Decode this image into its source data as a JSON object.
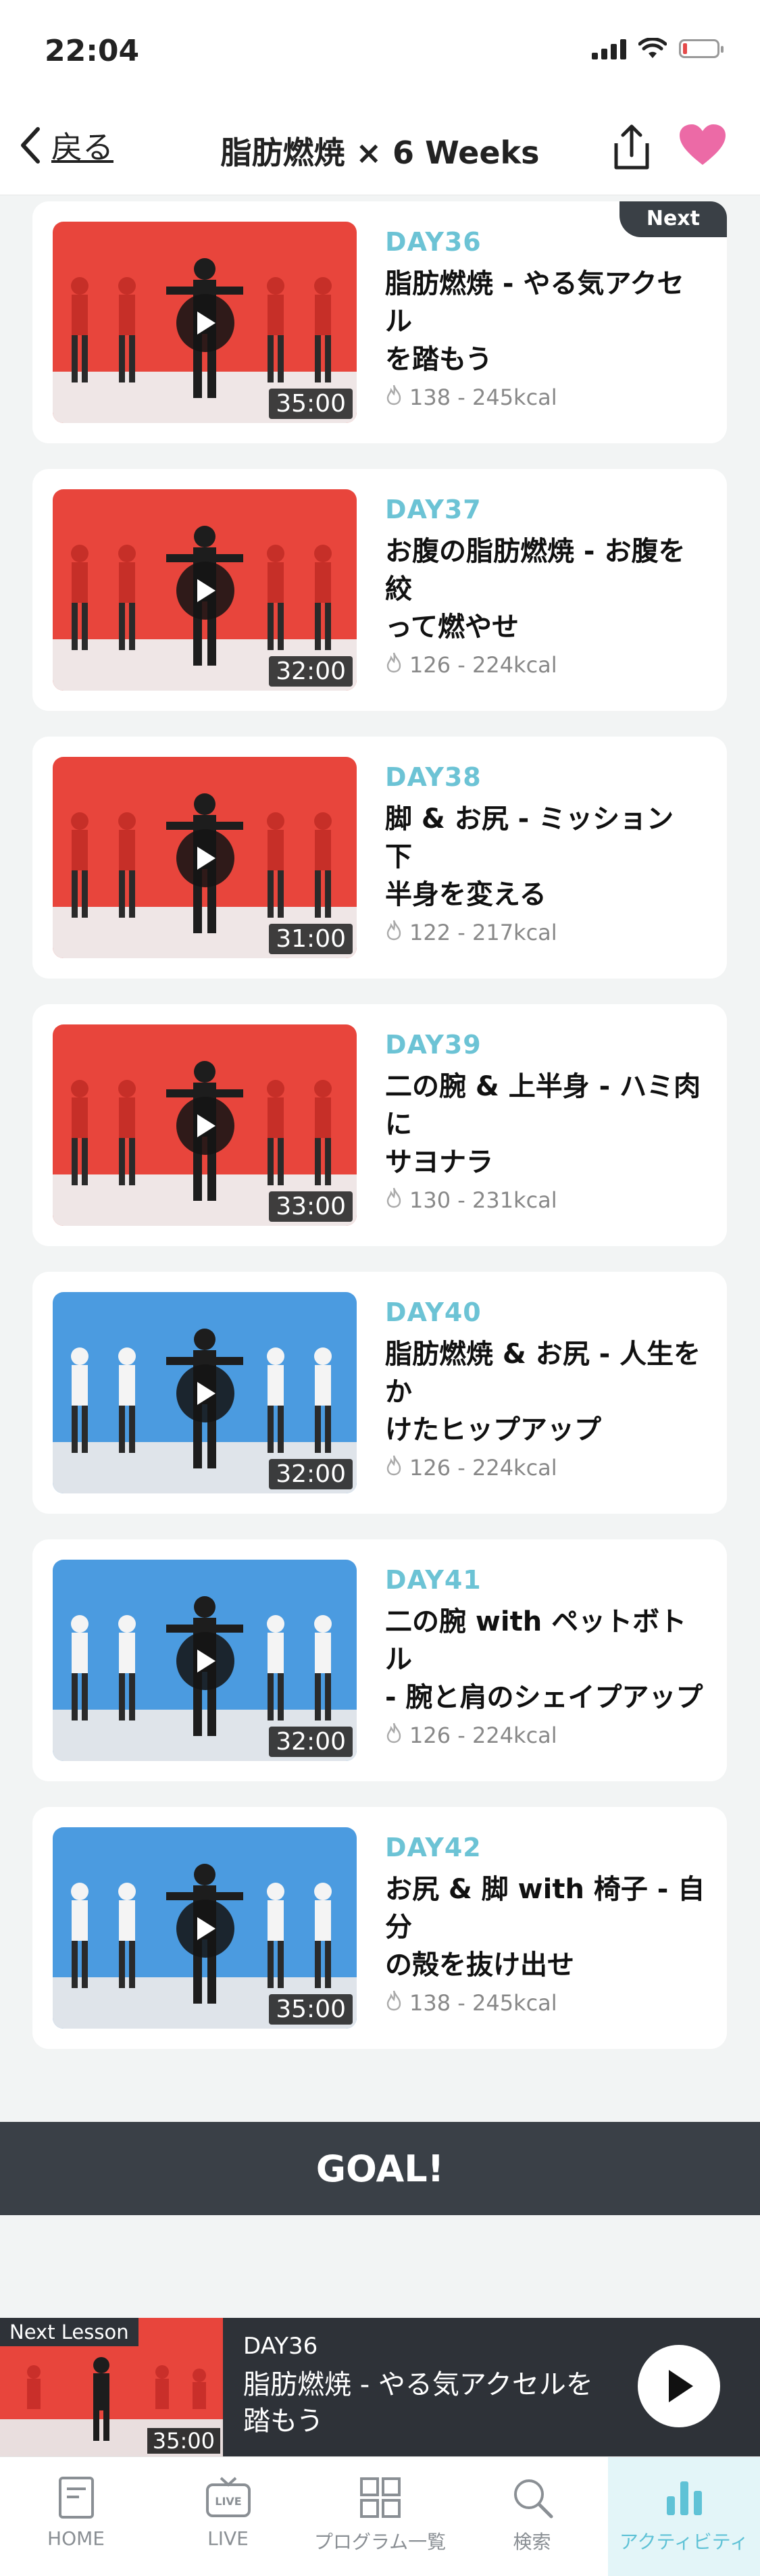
{
  "status_bar": {
    "time": "22:04"
  },
  "nav": {
    "back_label": "戻る",
    "title": "脂肪燃焼 × 6 Weeks"
  },
  "lessons": [
    {
      "day": "DAY36",
      "title_line1": "脂肪燃焼 - やる気アクセル",
      "title_line2": "を踏もう",
      "kcal": "138 - 245kcal",
      "duration": "35:00",
      "badge": "Next",
      "bg": "red"
    },
    {
      "day": "DAY37",
      "title_line1": "お腹の脂肪燃焼 - お腹を絞",
      "title_line2": "って燃やせ",
      "kcal": "126 - 224kcal",
      "duration": "32:00",
      "bg": "red"
    },
    {
      "day": "DAY38",
      "title_line1": "脚 & お尻 - ミッション 下",
      "title_line2": "半身を変える",
      "kcal": "122 - 217kcal",
      "duration": "31:00",
      "bg": "red"
    },
    {
      "day": "DAY39",
      "title_line1": "二の腕 & 上半身 - ハミ肉に",
      "title_line2": "サヨナラ",
      "kcal": "130 - 231kcal",
      "duration": "33:00",
      "bg": "red"
    },
    {
      "day": "DAY40",
      "title_line1": "脂肪燃焼 & お尻 - 人生をか",
      "title_line2": "けたヒップアップ",
      "kcal": "126 - 224kcal",
      "duration": "32:00",
      "bg": "blue"
    },
    {
      "day": "DAY41",
      "title_line1": "二の腕 with ペットボトル",
      "title_line2": "- 腕と肩のシェイプアップ",
      "kcal": "126 - 224kcal",
      "duration": "32:00",
      "bg": "blue"
    },
    {
      "day": "DAY42",
      "title_line1": "お尻 & 脚 with 椅子 - 自分",
      "title_line2": "の殻を抜け出せ",
      "kcal": "138 - 245kcal",
      "duration": "35:00",
      "bg": "blue"
    }
  ],
  "goal_label": "GOAL!",
  "next_bar": {
    "label": "Next Lesson",
    "day": "DAY36",
    "title_line1": "脂肪燃焼 - やる気アクセルを",
    "title_line2": "踏もう",
    "duration": "35:00"
  },
  "tabs": [
    {
      "label": "HOME",
      "icon": "home-icon",
      "active": false
    },
    {
      "label": "LIVE",
      "icon": "live-tv-icon",
      "active": false
    },
    {
      "label": "プログラム一覧",
      "icon": "grid-icon",
      "active": false
    },
    {
      "label": "検索",
      "icon": "search-icon",
      "active": false
    },
    {
      "label": "アクティビティ",
      "icon": "bar-chart-icon",
      "active": true
    }
  ],
  "colors": {
    "accent": "#5fc2d6",
    "day_label": "#6cc3d5",
    "heart": "#ec6aa6",
    "dark_bar": "#3a4047",
    "thumb_red": "#e8453c",
    "thumb_blue": "#4b9be0"
  }
}
